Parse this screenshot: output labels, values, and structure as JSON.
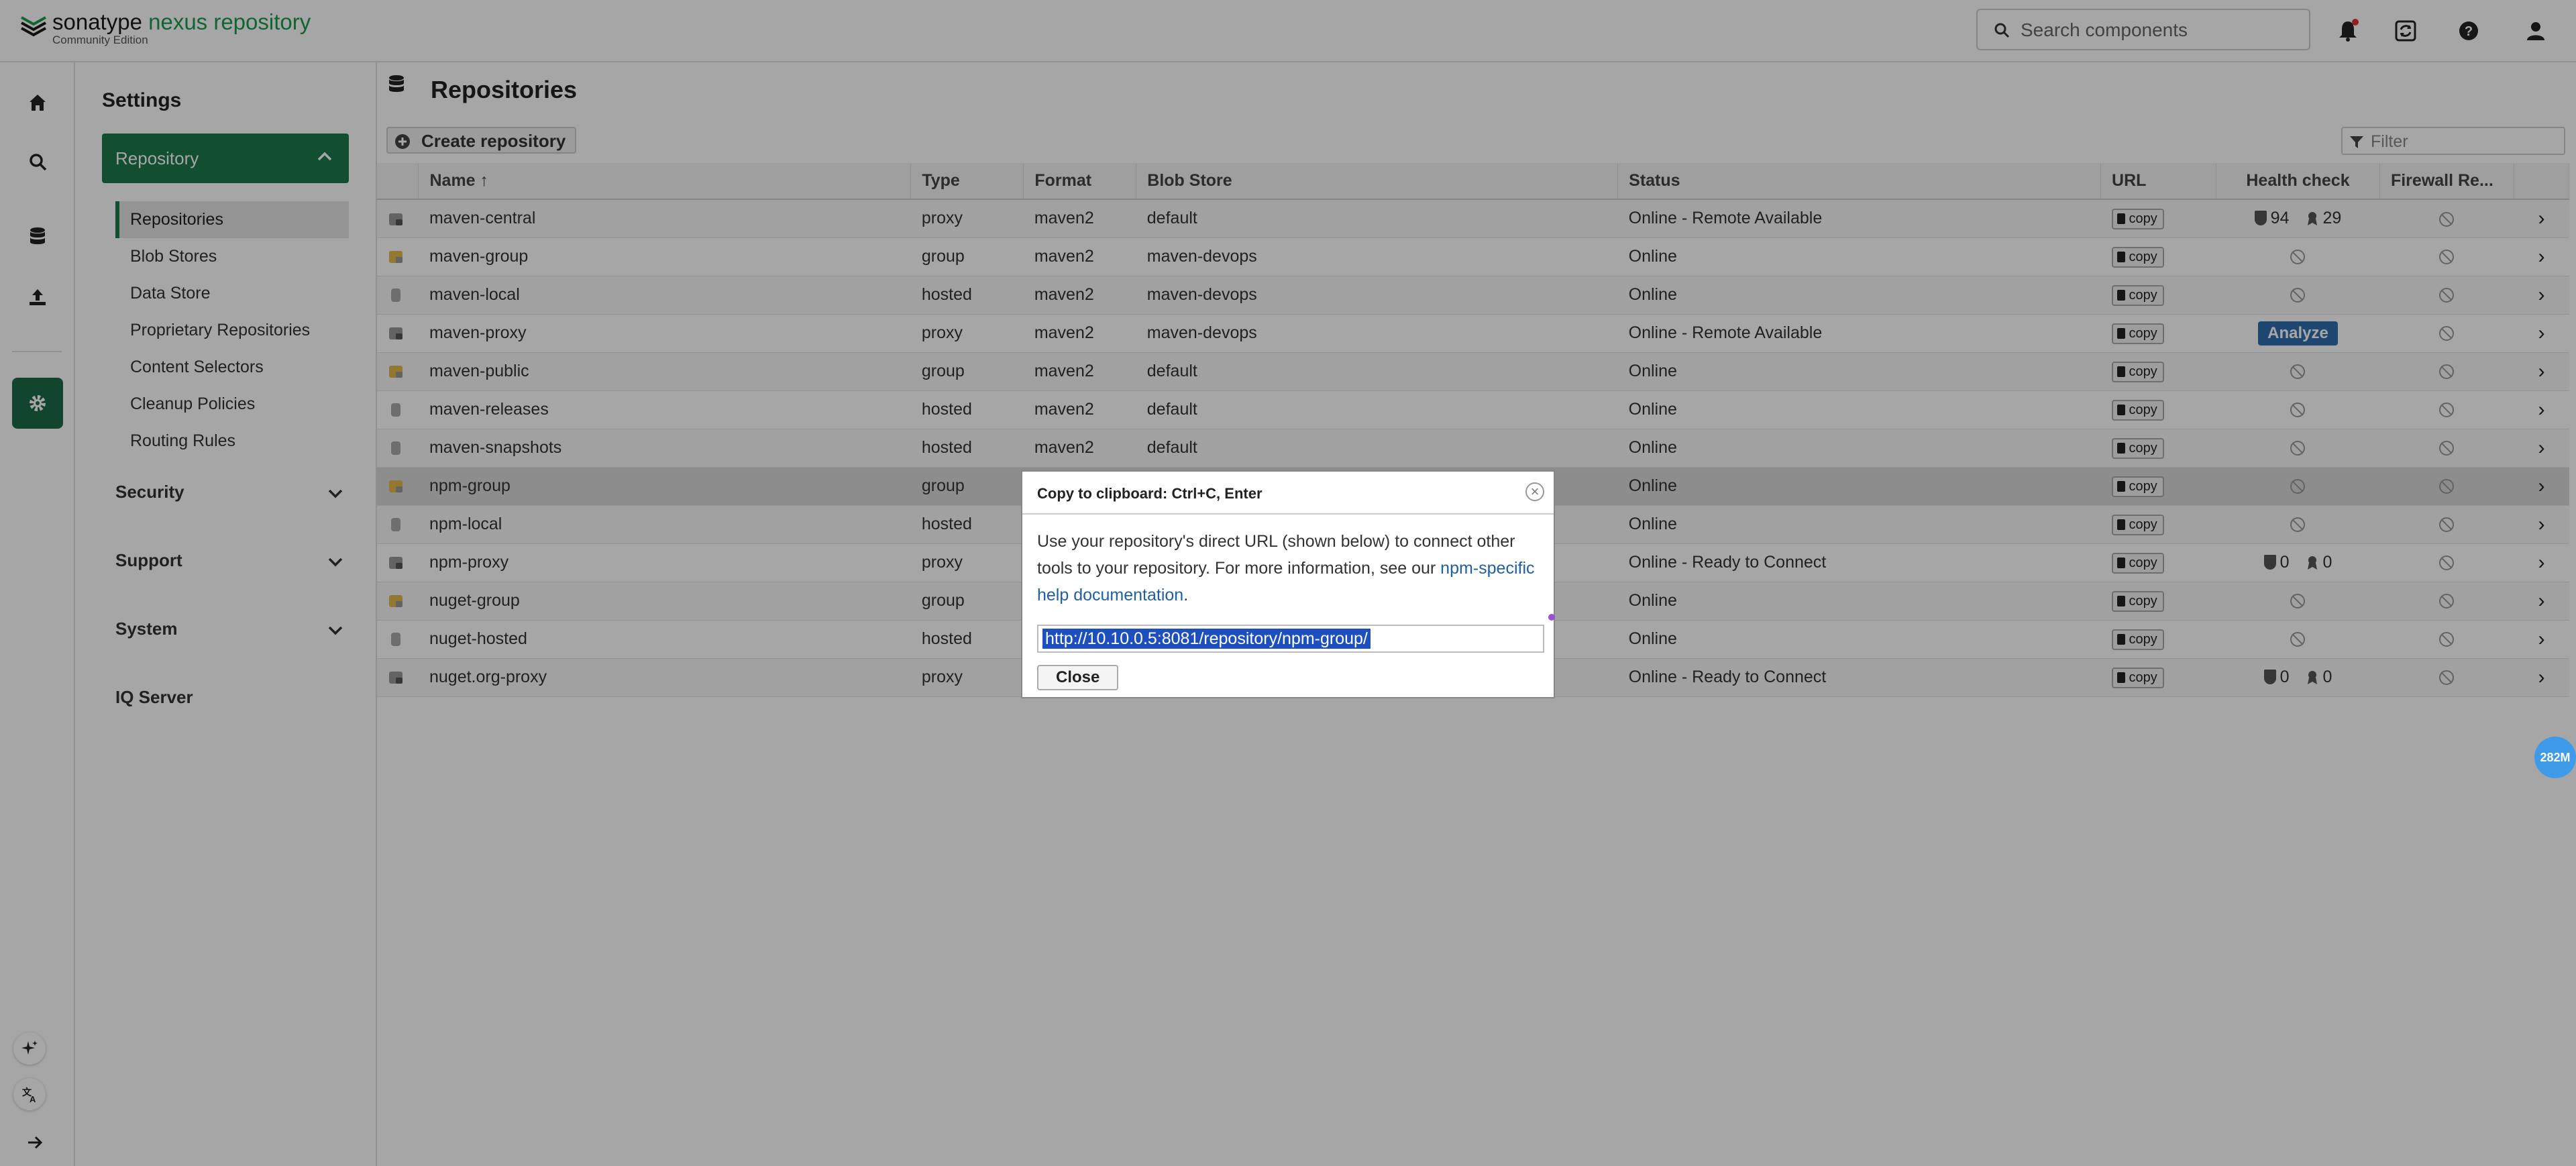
{
  "brand": {
    "name_part1": "sonatype",
    "name_part2": "nexus repository",
    "edition": "Community Edition"
  },
  "header": {
    "search_placeholder": "Search components"
  },
  "settings": {
    "title": "Settings",
    "repository_label": "Repository",
    "items": [
      "Repositories",
      "Blob Stores",
      "Data Store",
      "Proprietary Repositories",
      "Content Selectors",
      "Cleanup Policies",
      "Routing Rules"
    ],
    "security": "Security",
    "support": "Support",
    "system": "System",
    "iq_server": "IQ Server"
  },
  "main": {
    "title": "Repositories",
    "create_label": "Create repository",
    "filter_placeholder": "Filter",
    "columns": [
      "Name ↑",
      "Type",
      "Format",
      "Blob Store",
      "Status",
      "URL",
      "Health check",
      "Firewall Re..."
    ],
    "copy_label": "copy",
    "analyze_label": "Analyze",
    "rows": [
      {
        "name": "maven-central",
        "type": "proxy",
        "format": "maven2",
        "blob": "default",
        "status": "Online - Remote Available",
        "health": {
          "kind": "counts",
          "a": "94",
          "b": "29"
        }
      },
      {
        "name": "maven-group",
        "type": "group",
        "format": "maven2",
        "blob": "maven-devops",
        "status": "Online",
        "health": {
          "kind": "none"
        }
      },
      {
        "name": "maven-local",
        "type": "hosted",
        "format": "maven2",
        "blob": "maven-devops",
        "status": "Online",
        "health": {
          "kind": "none"
        }
      },
      {
        "name": "maven-proxy",
        "type": "proxy",
        "format": "maven2",
        "blob": "maven-devops",
        "status": "Online - Remote Available",
        "health": {
          "kind": "analyze"
        }
      },
      {
        "name": "maven-public",
        "type": "group",
        "format": "maven2",
        "blob": "default",
        "status": "Online",
        "health": {
          "kind": "none"
        }
      },
      {
        "name": "maven-releases",
        "type": "hosted",
        "format": "maven2",
        "blob": "default",
        "status": "Online",
        "health": {
          "kind": "none"
        }
      },
      {
        "name": "maven-snapshots",
        "type": "hosted",
        "format": "maven2",
        "blob": "default",
        "status": "Online",
        "health": {
          "kind": "none"
        }
      },
      {
        "name": "npm-group",
        "type": "group",
        "format": "",
        "blob": "",
        "status": "Online",
        "health": {
          "kind": "none"
        }
      },
      {
        "name": "npm-local",
        "type": "hosted",
        "format": "",
        "blob": "",
        "status": "Online",
        "health": {
          "kind": "none"
        }
      },
      {
        "name": "npm-proxy",
        "type": "proxy",
        "format": "",
        "blob": "",
        "status": "Online - Ready to Connect",
        "health": {
          "kind": "counts",
          "a": "0",
          "b": "0"
        }
      },
      {
        "name": "nuget-group",
        "type": "group",
        "format": "",
        "blob": "",
        "status": "Online",
        "health": {
          "kind": "none"
        }
      },
      {
        "name": "nuget-hosted",
        "type": "hosted",
        "format": "",
        "blob": "",
        "status": "Online",
        "health": {
          "kind": "none"
        }
      },
      {
        "name": "nuget.org-proxy",
        "type": "proxy",
        "format": "",
        "blob": "",
        "status": "Online - Ready to Connect",
        "health": {
          "kind": "counts",
          "a": "0",
          "b": "0"
        }
      }
    ]
  },
  "dialog": {
    "title": "Copy to clipboard: Ctrl+C, Enter",
    "body_text": "Use your repository's direct URL (shown below) to connect other tools to your repository. For more information, see our ",
    "link_text": "npm-specific help documentation",
    "body_end": ".",
    "url": "http://10.10.0.5:8081/repository/npm-group/",
    "close_label": "Close"
  },
  "memory_badge": "282M",
  "colors": {
    "brand_green": "#1d7a4b",
    "link_blue": "#1f5fa5",
    "analyze_blue": "#2f6eae"
  }
}
